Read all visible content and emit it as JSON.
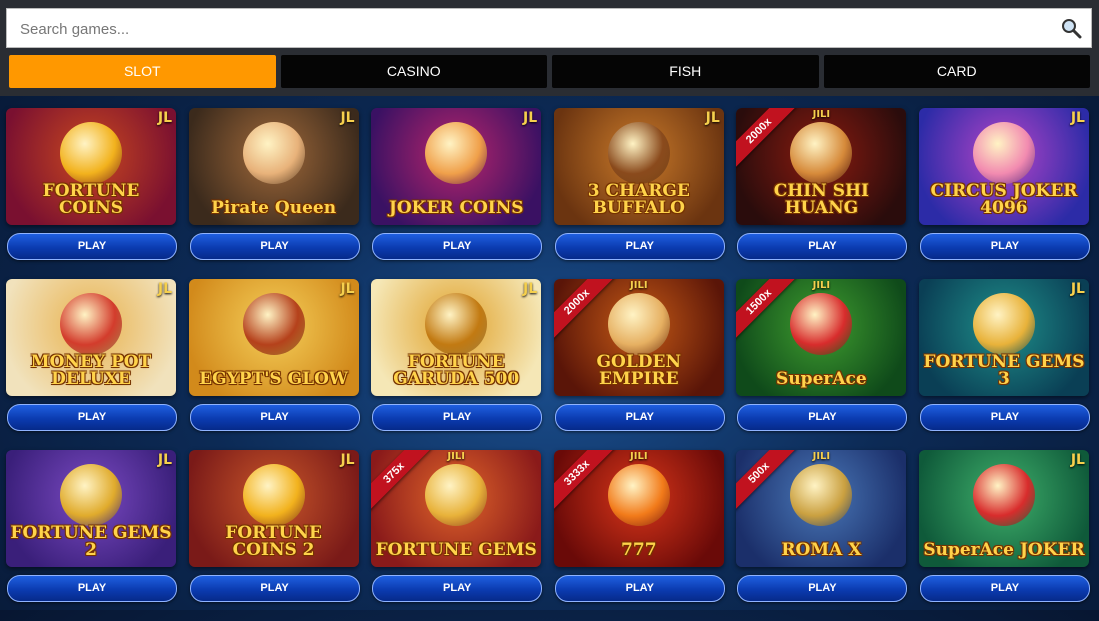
{
  "search": {
    "placeholder": "Search games...",
    "icon": "search-icon"
  },
  "tabs": [
    {
      "label": "SLOT",
      "active": true
    },
    {
      "label": "CASINO",
      "active": false
    },
    {
      "label": "FISH",
      "active": false
    },
    {
      "label": "CARD",
      "active": false
    }
  ],
  "colors": {
    "accent": "#ff9800",
    "play_button": "#0b3bb0",
    "tab_bg": "#050505"
  },
  "games": [
    {
      "title": "FORTUNE COINS",
      "provider": "JL",
      "ribbon": "",
      "play_label": "PLAY",
      "bg": [
        "#7a1030",
        "#c9481f"
      ],
      "art": "#f2b21d"
    },
    {
      "title": "Pirate Queen",
      "provider": "JL",
      "ribbon": "",
      "play_label": "PLAY",
      "bg": [
        "#3b2a1c",
        "#a0693a"
      ],
      "art": "#e8b27a"
    },
    {
      "title": "JOKER COINS",
      "provider": "JL",
      "ribbon": "",
      "play_label": "PLAY",
      "bg": [
        "#3a1163",
        "#b8256b"
      ],
      "art": "#f0a04a"
    },
    {
      "title": "3 CHARGE BUFFALO",
      "provider": "JL",
      "ribbon": "",
      "play_label": "PLAY",
      "bg": [
        "#6b3410",
        "#c97a2a"
      ],
      "art": "#8a4a1c"
    },
    {
      "title": "CHIN SHI HUANG",
      "provider": "JILI",
      "ribbon": "2000x",
      "play_label": "PLAY",
      "bg": [
        "#2a0c0c",
        "#8a1b10"
      ],
      "art": "#d68a3a"
    },
    {
      "title": "CIRCUS JOKER 4096",
      "provider": "JL",
      "ribbon": "",
      "play_label": "PLAY",
      "bg": [
        "#2c2ba7",
        "#b545c8"
      ],
      "art": "#f28bb0"
    },
    {
      "title": "MONEY POT DELUXE",
      "provider": "JL",
      "ribbon": "",
      "play_label": "PLAY",
      "bg": [
        "#f1e2bc",
        "#e9b24e"
      ],
      "art": "#d33c2c"
    },
    {
      "title": "EGYPT'S GLOW",
      "provider": "JL",
      "ribbon": "",
      "play_label": "PLAY",
      "bg": [
        "#d28a1b",
        "#f5cf5a"
      ],
      "art": "#b5411b"
    },
    {
      "title": "FORTUNE GARUDA 500",
      "provider": "JL",
      "ribbon": "",
      "play_label": "PLAY",
      "bg": [
        "#f5e7b6",
        "#e0a12a"
      ],
      "art": "#c27a12"
    },
    {
      "title": "GOLDEN EMPIRE",
      "provider": "JILI",
      "ribbon": "2000x",
      "play_label": "PLAY",
      "bg": [
        "#5a1508",
        "#c55a16"
      ],
      "art": "#e6b062"
    },
    {
      "title": "SuperAce",
      "provider": "JILI",
      "ribbon": "1500x",
      "play_label": "PLAY",
      "bg": [
        "#0f4a1a",
        "#3f9d2f"
      ],
      "art": "#d82c2c"
    },
    {
      "title": "FORTUNE GEMS 3",
      "provider": "JL",
      "ribbon": "",
      "play_label": "PLAY",
      "bg": [
        "#0a3f55",
        "#1f8f8a"
      ],
      "art": "#e8b23a"
    },
    {
      "title": "FORTUNE GEMS 2",
      "provider": "JL",
      "ribbon": "",
      "play_label": "PLAY",
      "bg": [
        "#3a1f7a",
        "#7a4ac2"
      ],
      "art": "#e0ab2c"
    },
    {
      "title": "FORTUNE COINS 2",
      "provider": "JL",
      "ribbon": "",
      "play_label": "PLAY",
      "bg": [
        "#7a1a18",
        "#c8562a"
      ],
      "art": "#f2b21d"
    },
    {
      "title": "FORTUNE GEMS",
      "provider": "JILI",
      "ribbon": "375x",
      "play_label": "PLAY",
      "bg": [
        "#8a1a1a",
        "#e0652a"
      ],
      "art": "#e8b23a"
    },
    {
      "title": "777",
      "provider": "JILI",
      "ribbon": "3333x",
      "play_label": "PLAY",
      "bg": [
        "#6a0a08",
        "#d9361a"
      ],
      "art": "#f27b1a"
    },
    {
      "title": "ROMA X",
      "provider": "JILI",
      "ribbon": "500x",
      "play_label": "PLAY",
      "bg": [
        "#1b2f6a",
        "#4a78b8"
      ],
      "art": "#caa040"
    },
    {
      "title": "SuperAce JOKER",
      "provider": "JL",
      "ribbon": "",
      "play_label": "PLAY",
      "bg": [
        "#0f5a3a",
        "#3fb06b"
      ],
      "art": "#d82c2c"
    }
  ]
}
